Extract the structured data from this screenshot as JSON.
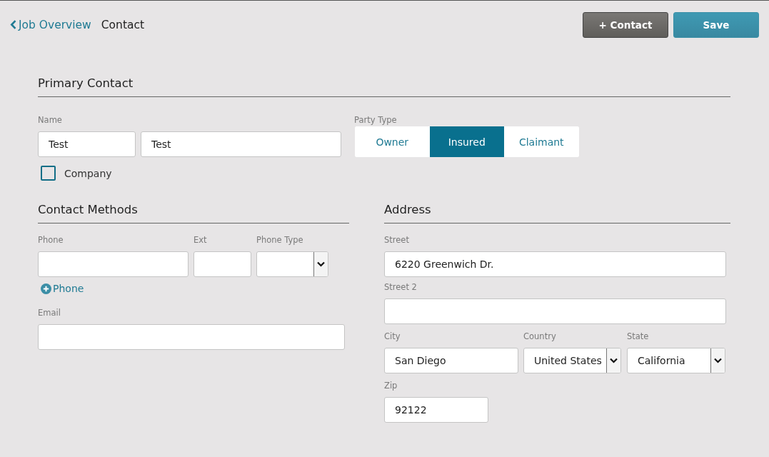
{
  "header": {
    "back_link": "Job Overview",
    "title": "Contact",
    "buttons": [
      {
        "label": "+ Contact",
        "kind": "secondary"
      },
      {
        "label": "Save",
        "kind": "primary"
      }
    ]
  },
  "primary_contact": {
    "heading": "Primary Contact",
    "name": {
      "label": "Name",
      "fields": [
        {
          "kind": "text",
          "value": "Test"
        },
        {
          "kind": "text",
          "value": "Test"
        }
      ]
    },
    "company": {
      "label": "Company",
      "checked": false
    },
    "party_type": {
      "label": "Party Type",
      "options": [
        {
          "label": "Owner",
          "selected": false
        },
        {
          "label": "Insured",
          "selected": true
        },
        {
          "label": "Claimant",
          "selected": false
        }
      ]
    }
  },
  "contact_methods": {
    "heading": "Contact Methods",
    "rows": [
      [
        {
          "label": "Phone",
          "kind": "text"
        },
        {
          "label": "Ext",
          "kind": "text"
        },
        {
          "label": "Phone Type",
          "kind": "select"
        }
      ],
      [
        {
          "label": "Phone",
          "kind": "add_link"
        }
      ],
      [
        {
          "label": "Email",
          "kind": "text"
        }
      ]
    ]
  },
  "address": {
    "heading": "Address",
    "rows": [
      [
        {
          "label": "Street",
          "kind": "text",
          "value": "6220 Greenwich Dr."
        }
      ],
      [
        {
          "label": "Street 2",
          "kind": "text"
        }
      ],
      [
        {
          "label": "City",
          "kind": "text",
          "value": "San Diego"
        },
        {
          "label": "Country",
          "kind": "select",
          "value": "United States"
        },
        {
          "label": "State",
          "kind": "select",
          "value": "California"
        }
      ],
      [
        {
          "label": "Zip",
          "kind": "text",
          "value": "92122"
        }
      ]
    ]
  }
}
